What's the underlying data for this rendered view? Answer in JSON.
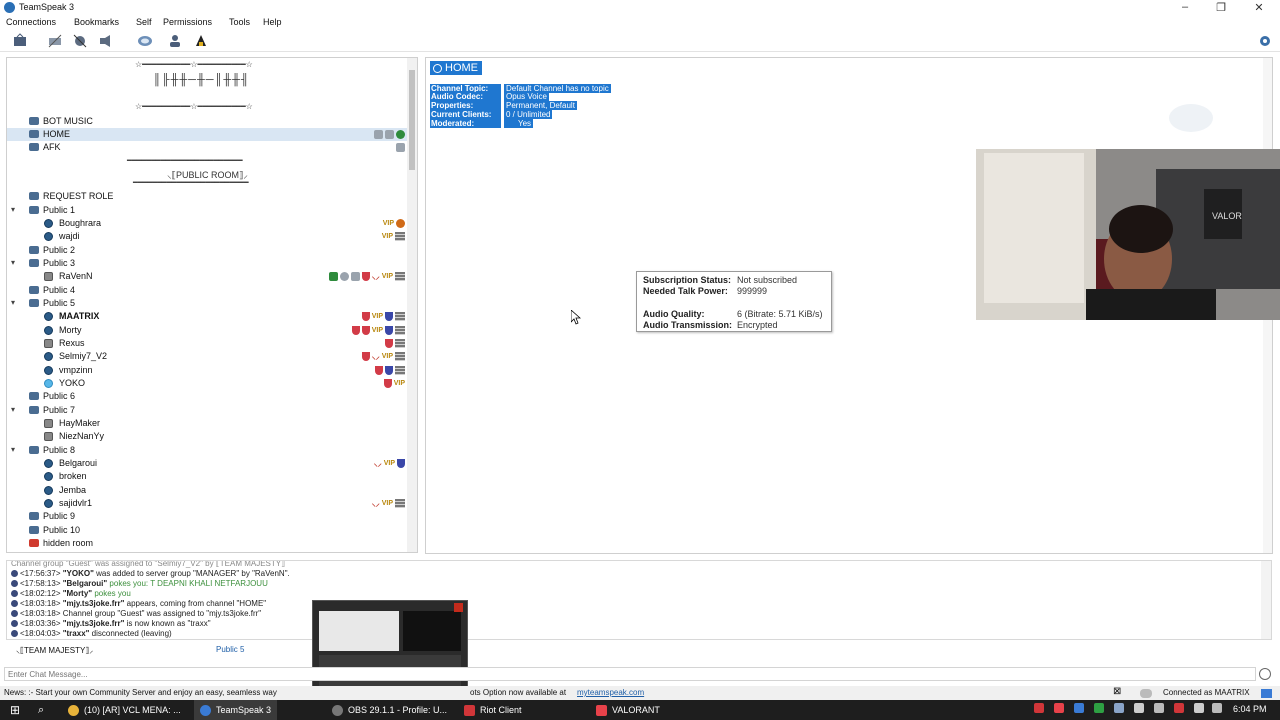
{
  "window": {
    "title": "TeamSpeak 3",
    "controls": [
      "–",
      "❐",
      "✕"
    ]
  },
  "menu": [
    "Connections",
    "Bookmarks",
    "Self",
    "Permissions",
    "Tools",
    "Help"
  ],
  "toolbar_icons": [
    "connect-icon",
    "disconnect-icon",
    "mute-mic-icon",
    "mute-speakers-icon",
    "away-icon",
    "contacts-icon",
    "ownership-icon"
  ],
  "tree": {
    "decor": {
      "top1": "☆━━━━━━━━━━☆━━━━━━━━━━☆",
      "top2": "║╟╫╫─╫─║╫╫╢",
      "top3": "☆━━━━━━━━━━☆━━━━━━━━━━☆",
      "public_room": "⸜⟦PUBLIC ROOM⟧⸝",
      "left_line": "━━━━━━━━━━━━━━━━━━━━━━━━",
      "right_line": "━━━━━━━━━━━━━━━━━━━━━━━━"
    },
    "rows": [
      {
        "type": "channel",
        "label": "BOT MUSIC"
      },
      {
        "type": "channel",
        "label": "HOME"
      },
      {
        "type": "channel",
        "label": "AFK"
      },
      {
        "type": "channel",
        "label": "REQUEST ROLE"
      },
      {
        "type": "channel",
        "label": "Public 1"
      },
      {
        "type": "user",
        "label": "Boughrara"
      },
      {
        "type": "user",
        "label": "wajdi"
      },
      {
        "type": "channel",
        "label": "Public 2"
      },
      {
        "type": "channel",
        "label": "Public 3"
      },
      {
        "type": "user",
        "label": "RaVenN"
      },
      {
        "type": "channel",
        "label": "Public 4"
      },
      {
        "type": "channel",
        "label": "Public 5"
      },
      {
        "type": "user",
        "label": "MAATRIX"
      },
      {
        "type": "user",
        "label": "Morty"
      },
      {
        "type": "user",
        "label": "Rexus"
      },
      {
        "type": "user",
        "label": "Selmiy7_V2"
      },
      {
        "type": "user",
        "label": "vmpzinn"
      },
      {
        "type": "user",
        "label": "YOKO"
      },
      {
        "type": "channel",
        "label": "Public 6"
      },
      {
        "type": "channel",
        "label": "Public 7"
      },
      {
        "type": "user",
        "label": "HayMaker"
      },
      {
        "type": "user",
        "label": "NiezNanYy"
      },
      {
        "type": "channel",
        "label": "Public 8"
      },
      {
        "type": "user",
        "label": "Belgaroui"
      },
      {
        "type": "user",
        "label": "broken"
      },
      {
        "type": "user",
        "label": "Jemba"
      },
      {
        "type": "user",
        "label": "sajidvlr1"
      },
      {
        "type": "channel",
        "label": "Public 9"
      },
      {
        "type": "channel",
        "label": "Public 10"
      },
      {
        "type": "channel",
        "label": "hidden room"
      }
    ],
    "vip": "VIP"
  },
  "channel_info": {
    "title": "HOME",
    "props": [
      {
        "key": "Channel Topic:",
        "value": "Default Channel has no topic"
      },
      {
        "key": "Audio Codec:",
        "value": "Opus Voice"
      },
      {
        "key": "Properties:",
        "value": "Permanent, Default"
      },
      {
        "key": "Current Clients:",
        "value": "0 / Unlimited"
      },
      {
        "key": "Moderated:",
        "value": "Yes"
      }
    ]
  },
  "tooltip": {
    "sub_key": "Subscription Status:",
    "sub_val": "Not subscribed",
    "talk_key": "Needed Talk Power:",
    "talk_val": "999999",
    "quality_key": "Audio Quality:",
    "quality_val": "6 (Bitrate: 5.71 KiB/s)",
    "trans_key": "Audio Transmission:",
    "trans_val": "Encrypted"
  },
  "log": [
    {
      "time": "<17:56:37>",
      "user": "\"YOKO\"",
      "text": " was added to server group \"MANAGER\" by \"RaVenN\"."
    },
    {
      "time": "<17:58:13>",
      "user": "\"Belgaroui\"",
      "text": " pokes you: T DEAPNI KHALI NETFARJOUU",
      "green": true
    },
    {
      "time": "<18:02:12>",
      "user": "\"Morty\"",
      "text": " pokes you",
      "green": true
    },
    {
      "time": "<18:03:18>",
      "user": "\"mjy.ts3joke.frr\"",
      "text": " appears, coming from channel \"HOME\""
    },
    {
      "time": "<18:03:18>",
      "user": "",
      "text": "Channel group \"Guest\" was assigned to \"mjy.ts3joke.frr\""
    },
    {
      "time": "<18:03:36>",
      "user": "\"mjy.ts3joke.frr\"",
      "text": " is now known as \"traxx\""
    },
    {
      "time": "<18:04:03>",
      "user": "\"traxx\"",
      "text": " disconnected (leaving)"
    }
  ],
  "log_partial_top": "Channel group \"Guest\" was assigned to \"Selmiy7_V2\" by ⟦TEAM MAJESTY⟧",
  "chat_tabs": [
    "⸜⟦TEAM MAJESTY⟧⸝",
    "Public 5"
  ],
  "chat_placeholder": "Enter Chat Message...",
  "status": {
    "news": "News: :- Start your own Community Server and enjoy an easy, seamless way",
    "news_tail": "ots Option now available at",
    "link": "myteamspeak.com",
    "connected": "Connected as MAATRIX"
  },
  "taskbar": {
    "items": [
      {
        "label": "(10) [AR] VCL MENA: ...",
        "color": "#e8b33a"
      },
      {
        "label": "TeamSpeak 3",
        "color": "#3a7bd5",
        "active": true
      },
      {
        "label": "OBS 29.1.1 - Profile: U...",
        "color": "#777777"
      },
      {
        "label": "Riot Client",
        "color": "#d13639"
      },
      {
        "label": "VALORANT",
        "color": "#e8424a"
      }
    ],
    "time": "6:04 PM"
  }
}
